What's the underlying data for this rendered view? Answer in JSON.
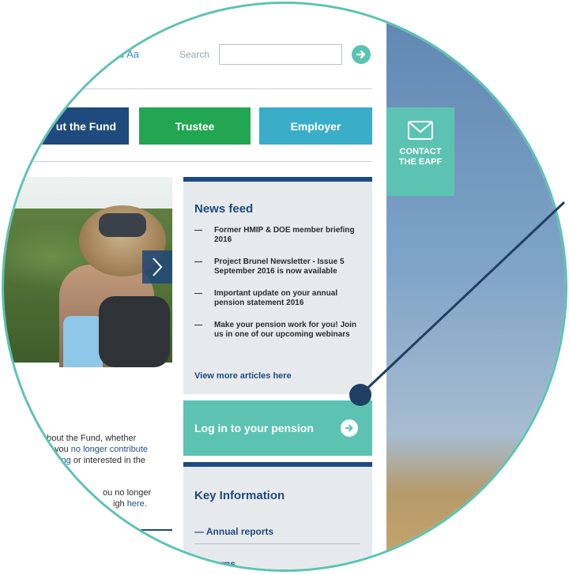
{
  "header": {
    "logo_fragment": "d Aa",
    "search_label": "Search",
    "search_value": ""
  },
  "nav": [
    {
      "label": "ut the Fund",
      "color": "#1f4a7d"
    },
    {
      "label": "Trustee",
      "color": "#22a652"
    },
    {
      "label": "Employer",
      "color": "#3aaec9"
    }
  ],
  "news": {
    "title": "News feed",
    "items": [
      "Former HMIP & DOE member briefing 2016",
      "Project Brunel Newsletter - Issue 5 September 2016 is now available",
      "Important update on your annual pension statement 2016",
      "Make your pension work for you! Join us in one of our upcoming webinars"
    ],
    "more": "View more articles here"
  },
  "login": {
    "label": "Log in to your pension"
  },
  "key_info": {
    "title": "Key Information",
    "links": [
      "— Annual reports",
      "— Forms"
    ]
  },
  "contact": {
    "line1": "CONTACT",
    "line2": "THE EAPF"
  },
  "body": {
    "frag1": "about the Fund, whether",
    "frag2a": "you ",
    "frag2b": "no longer contribute",
    "frag3a": "ning",
    "frag3b": " or interested in the",
    "frag4": "ou no longer",
    "frag5a": "igh ",
    "frag5b": "here",
    "frag5c": "."
  },
  "colors": {
    "accent": "#5cc3b2",
    "navy": "#1f4a7d",
    "green": "#22a652",
    "cyan": "#3aaec9"
  }
}
